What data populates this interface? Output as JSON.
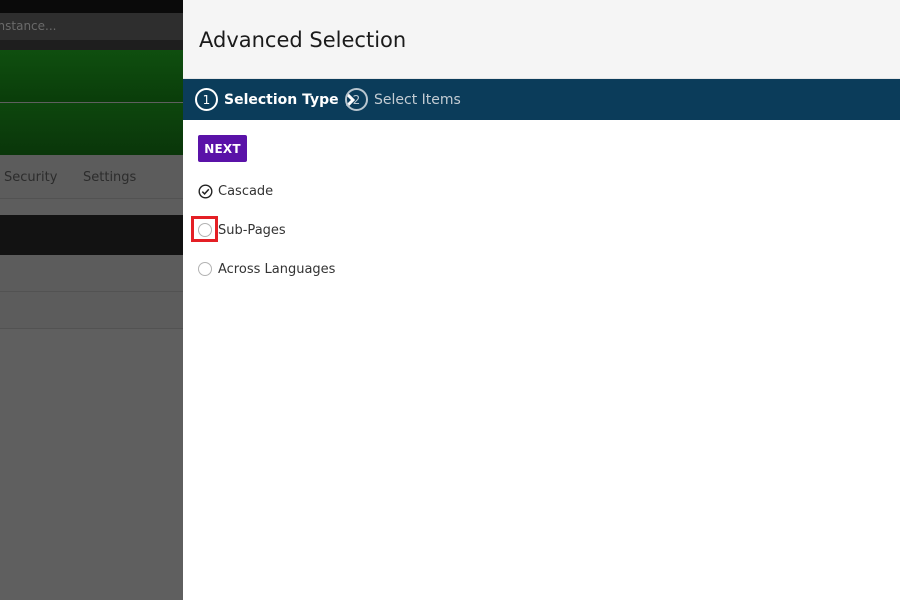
{
  "background_app": {
    "search_placeholder": "Instance...",
    "tabs": [
      "Security",
      "Settings"
    ]
  },
  "panel": {
    "title": "Advanced Selection",
    "steps": [
      {
        "number": "1",
        "label": "Selection Type",
        "active": true
      },
      {
        "number": "2",
        "label": "Select Items",
        "active": false
      }
    ],
    "next_label": "NEXT",
    "options": [
      {
        "label": "Cascade",
        "selected": true
      },
      {
        "label": "Sub-Pages",
        "selected": false,
        "highlighted": true
      },
      {
        "label": "Across Languages",
        "selected": false
      }
    ]
  },
  "colors": {
    "steps_bar": "#0b3c5a",
    "next_button": "#5a12a8",
    "highlight": "#e41f25",
    "overlay": "#5f5f5f"
  },
  "icons": {
    "step_separator": "chevron-right-icon",
    "selected_option": "check-circle-icon",
    "unselected_option": "radio-empty-icon"
  }
}
